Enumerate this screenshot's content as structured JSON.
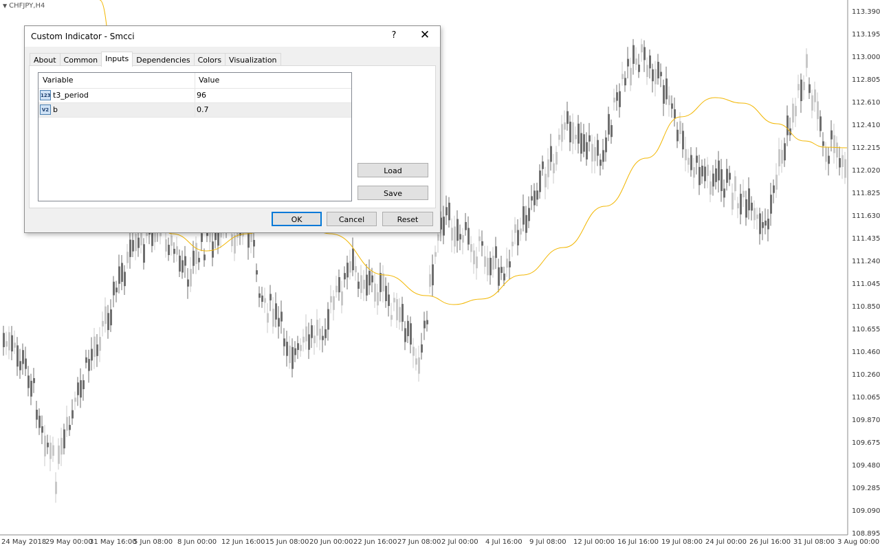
{
  "chart": {
    "symbol_label": "CHFJPY,H4",
    "price_axis": [
      "113.390",
      "113.195",
      "113.000",
      "112.805",
      "112.610",
      "112.410",
      "112.215",
      "112.020",
      "111.825",
      "111.630",
      "111.435",
      "111.240",
      "111.045",
      "110.850",
      "110.655",
      "110.460",
      "110.260",
      "110.065",
      "109.870",
      "109.675",
      "109.480",
      "109.285",
      "109.090",
      "108.895"
    ],
    "time_axis": [
      "24 May 2018",
      "29 May 00:00",
      "31 May 16:00",
      "5 Jun 08:00",
      "8 Jun 00:00",
      "12 Jun 16:00",
      "15 Jun 08:00",
      "20 Jun 00:00",
      "22 Jun 16:00",
      "27 Jun 08:00",
      "2 Jul 00:00",
      "4 Jul 16:00",
      "9 Jul 08:00",
      "12 Jul 00:00",
      "16 Jul 16:00",
      "19 Jul 08:00",
      "24 Jul 00:00",
      "26 Jul 16:00",
      "31 Jul 08:00",
      "3 Aug 00:00"
    ],
    "colors": {
      "bull": "#c8c8c8",
      "bear": "#6e6e6e",
      "indicator": "#f2b600",
      "background": "#ffffff"
    }
  },
  "dialog": {
    "title": "Custom Indicator - Smcci",
    "help_label": "?",
    "close_label": "✕",
    "tabs": [
      "About",
      "Common",
      "Inputs",
      "Dependencies",
      "Colors",
      "Visualization"
    ],
    "active_tab": "Inputs",
    "grid": {
      "headers": {
        "variable": "Variable",
        "value": "Value"
      },
      "rows": [
        {
          "icon": "123",
          "name": "t3_period",
          "value": "96"
        },
        {
          "icon": "V2",
          "name": "b",
          "value": "0.7"
        }
      ]
    },
    "buttons": {
      "load": "Load",
      "save": "Save",
      "ok": "OK",
      "cancel": "Cancel",
      "reset": "Reset"
    }
  }
}
